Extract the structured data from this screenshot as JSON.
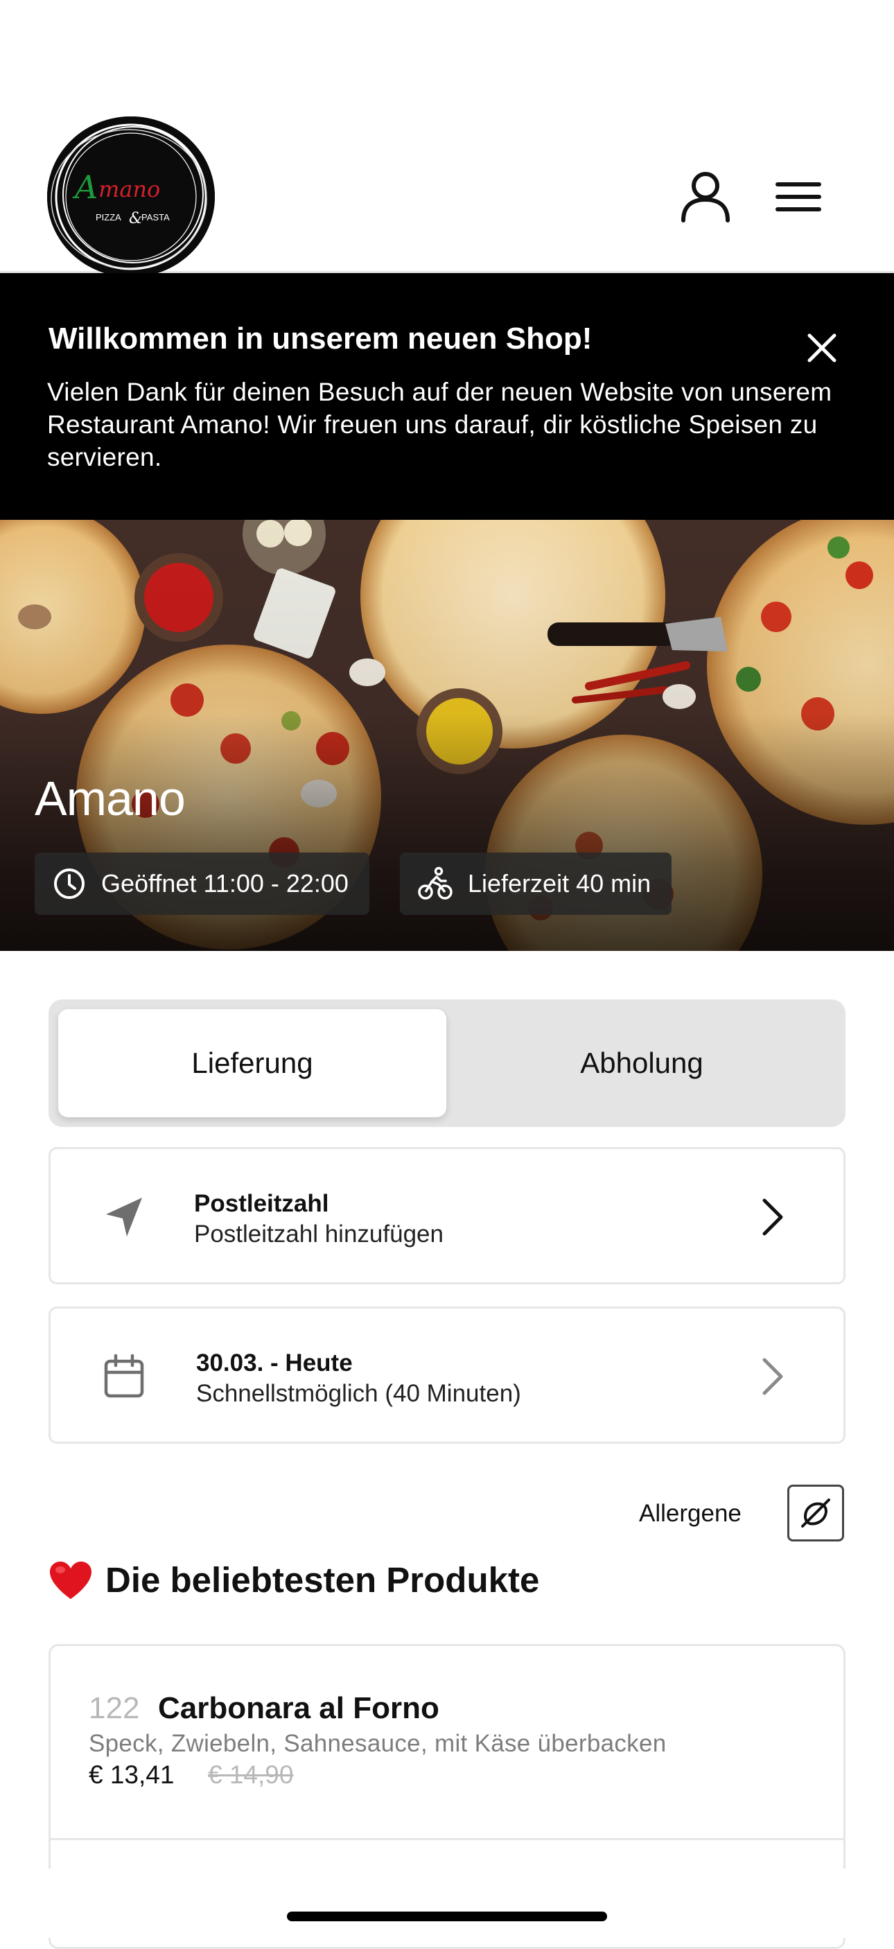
{
  "header": {
    "logo": {
      "brand": "Amano",
      "tagline": "PIZZA & PASTA"
    }
  },
  "banner": {
    "title": "Willkommen in unserem neuen Shop!",
    "text": "Vielen Dank für deinen Besuch auf der neuen Website von unserem Restaurant Amano! Wir freuen uns darauf, dir köstliche Speisen zu servieren."
  },
  "hero": {
    "name": "Amano",
    "hours": "Geöffnet 11:00 - 22:00",
    "delivery_time": "Lieferzeit 40 min"
  },
  "order_mode": {
    "options": [
      "Lieferung",
      "Abholung"
    ],
    "selected": "Lieferung"
  },
  "postal_card": {
    "title": "Postleitzahl",
    "subtitle": "Postleitzahl hinzufügen"
  },
  "date_card": {
    "title": "30.03. - Heute",
    "subtitle": "Schnellstmöglich (40 Minuten)"
  },
  "allergene": {
    "label": "Allergene"
  },
  "popular": {
    "title": "Die beliebtesten Produkte",
    "products": [
      {
        "number": "122",
        "name": "Carbonara al Forno",
        "description": "Speck, Zwiebeln, Sahnesauce, mit Käse überbacken",
        "price": "€ 13,41",
        "old_price": "€ 14,90"
      }
    ]
  },
  "colors": {
    "banner_bg": "#000000",
    "toggle_bg": "#e4e4e4",
    "logo_green": "#1f9a3a",
    "logo_red": "#d4202a",
    "heart": "#e0141e"
  }
}
